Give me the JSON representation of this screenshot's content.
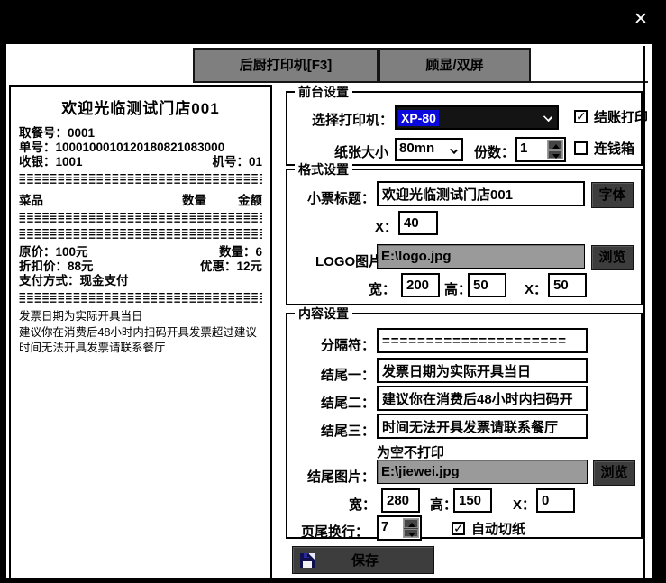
{
  "window": {
    "close_icon": "✕"
  },
  "tabs": {
    "kitchen_printer": "后厨打印机[F3]",
    "customer_display": "顾显/双屏"
  },
  "receipt": {
    "title": "欢迎光临测试门店001",
    "pickup_no": "取餐号：0001",
    "order_no": "单号：1000100010120180821083000",
    "cashier": "收银：1001",
    "machine_no": "机号：01",
    "separator": "=================================",
    "col_item": "菜品",
    "col_qty": "数量",
    "col_amount": "金额",
    "orig_price": "原价：100元",
    "qty": "数量：6",
    "discount_price": "折扣价：88元",
    "discount": "优惠：12元",
    "payment": "支付方式：现金支付",
    "notes": [
      "发票日期为实际开具当日",
      "建议你在消费后48小时内扫码开具发票超过建议",
      "时间无法开具发票请联系餐厅"
    ]
  },
  "front_group": {
    "title": "前台设置",
    "printer_label": "选择打印机：",
    "printer_value": "XP-80",
    "paper_label": "纸张大小",
    "paper_value": "80mn",
    "copies_label": "份数：",
    "copies_value": "1",
    "checkout_print_label": "结账打印",
    "cash_drawer_label": "连钱箱"
  },
  "format_group": {
    "title": "格式设置",
    "receipt_title_label": "小票标题：",
    "receipt_title_value": "欢迎光临测试门店001",
    "font_button": "字体",
    "x_label": "X：",
    "x_value": "40",
    "logo_label": "LOGO图片",
    "logo_value": "E:\\logo.jpg",
    "browse_button": "浏览",
    "width_label": "宽：",
    "width_value": "200",
    "height_label": "高：",
    "height_value": "50",
    "x2_label": "X：",
    "x2_value": "50"
  },
  "content_group": {
    "title": "内容设置",
    "divider_label": "分隔符：",
    "divider_value": "=====================",
    "footer1_label": "结尾一：",
    "footer1_value": "发票日期为实际开具当日",
    "footer2_label": "结尾二：",
    "footer2_value": "建议你在消费后48小时内扫码开",
    "footer3_label": "结尾三：",
    "footer3_value": "时间无法开具发票请联系餐厅",
    "empty_hint": "为空不打印",
    "footer_img_label": "结尾图片：",
    "footer_img_value": "E:\\jiewei.jpg",
    "browse_button": "浏览",
    "width_label": "宽：",
    "width_value": "280",
    "height_label": "高：",
    "height_value": "150",
    "x_label": "X：",
    "x_value": "0",
    "page_break_label": "页尾换行：",
    "page_break_value": "7",
    "auto_cut_label": "自动切纸"
  },
  "save": {
    "label": "保存"
  },
  "icons": {
    "check": "✓"
  },
  "colors": {
    "tab_gray": "#7f7f7f",
    "button_dark": "#3d3d3d",
    "input_gray": "#9a9a9a",
    "selection_blue": "#0a0adf",
    "combo_black": "#141414"
  }
}
